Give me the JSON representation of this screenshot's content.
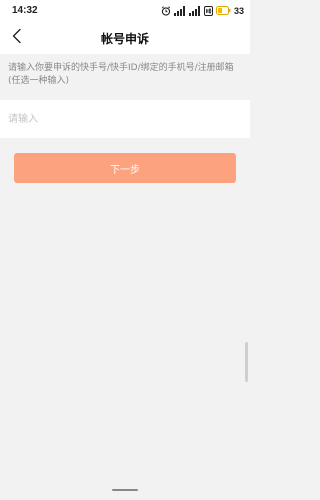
{
  "status_bar": {
    "time": "14:32",
    "battery": "33",
    "icons": [
      "alarm-icon",
      "signal-icon",
      "signal-icon",
      "hd-icon",
      "battery-icon"
    ]
  },
  "nav": {
    "title": "帐号申诉",
    "back_icon": "chevron-left-icon"
  },
  "form": {
    "hint": "请输入你要申诉的快手号/快手ID/绑定的手机号/注册邮箱(任选一种输入)",
    "input_value": "",
    "input_placeholder": "请输入",
    "next_label": "下一步"
  },
  "colors": {
    "background": "#f2f2f2",
    "surface": "#ffffff",
    "accent": "#fda27f",
    "hint_text": "#888888",
    "placeholder": "#c4c4c4"
  }
}
